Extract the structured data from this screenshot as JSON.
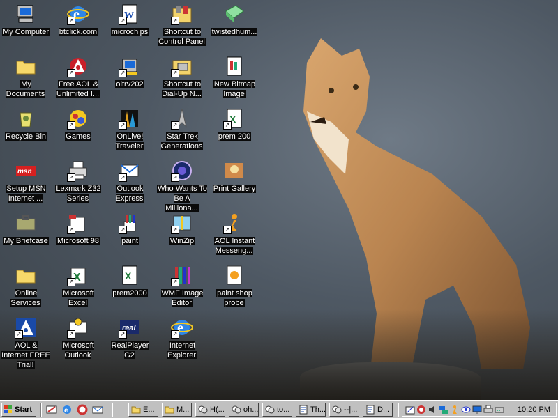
{
  "desktop": {
    "icons": [
      {
        "label": "My Computer",
        "icon": "my-computer-icon",
        "shortcut": false
      },
      {
        "label": "btclick.com",
        "icon": "ie-icon",
        "shortcut": true
      },
      {
        "label": "microchips",
        "icon": "word-doc-icon",
        "shortcut": true
      },
      {
        "label": "Shortcut to Control Panel",
        "icon": "control-panel-icon",
        "shortcut": true
      },
      {
        "label": "twistedhum...",
        "icon": "package-icon",
        "shortcut": false
      },
      {
        "label": "My Documents",
        "icon": "folder-icon",
        "shortcut": false
      },
      {
        "label": "Free AOL & Unlimited I...",
        "icon": "aol-icon",
        "shortcut": true
      },
      {
        "label": "oltrv202",
        "icon": "installer-icon",
        "shortcut": true
      },
      {
        "label": "Shortcut to Dial-Up N...",
        "icon": "dialup-icon",
        "shortcut": true
      },
      {
        "label": "New Bitmap Image",
        "icon": "bitmap-icon",
        "shortcut": false
      },
      {
        "label": "Recycle Bin",
        "icon": "recycle-bin-icon",
        "shortcut": false
      },
      {
        "label": "Games",
        "icon": "games-icon",
        "shortcut": true
      },
      {
        "label": "OnLive! Traveler",
        "icon": "onlive-icon",
        "shortcut": true
      },
      {
        "label": "Star Trek Generations",
        "icon": "star-trek-icon",
        "shortcut": true
      },
      {
        "label": "prem 200",
        "icon": "excel-doc-icon",
        "shortcut": true
      },
      {
        "label": "Setup MSN Internet ...",
        "icon": "msn-icon",
        "shortcut": false
      },
      {
        "label": "Lexmark Z32 Series",
        "icon": "printer-icon",
        "shortcut": true
      },
      {
        "label": "Outlook Express",
        "icon": "outlook-express-icon",
        "shortcut": true
      },
      {
        "label": "Who Wants To Be A Milliona...",
        "icon": "millionaire-icon",
        "shortcut": true
      },
      {
        "label": "Print Gallery",
        "icon": "print-gallery-icon",
        "shortcut": false
      },
      {
        "label": "My Briefcase",
        "icon": "briefcase-icon",
        "shortcut": false
      },
      {
        "label": "Microsoft  98",
        "icon": "ms98-icon",
        "shortcut": true
      },
      {
        "label": "paint",
        "icon": "paint-icon",
        "shortcut": true
      },
      {
        "label": "WinZip",
        "icon": "winzip-icon",
        "shortcut": true
      },
      {
        "label": "AOL Instant Messeng...",
        "icon": "aim-icon",
        "shortcut": true
      },
      {
        "label": "Online Services",
        "icon": "folder-icon",
        "shortcut": false
      },
      {
        "label": "Microsoft Excel",
        "icon": "excel-icon",
        "shortcut": true
      },
      {
        "label": "prem2000",
        "icon": "excel-doc-icon",
        "shortcut": false
      },
      {
        "label": "WMF Image Editor",
        "icon": "wmf-editor-icon",
        "shortcut": true
      },
      {
        "label": "paint shop probe",
        "icon": "paint-shop-icon",
        "shortcut": false
      },
      {
        "label": "AOL & Internet FREE Trial!",
        "icon": "aol-triangle-icon",
        "shortcut": true
      },
      {
        "label": "Microsoft Outlook",
        "icon": "outlook-icon",
        "shortcut": true
      },
      {
        "label": "RealPlayer G2",
        "icon": "realplayer-icon",
        "shortcut": true
      },
      {
        "label": "Internet Explorer",
        "icon": "ie-icon",
        "shortcut": true
      }
    ]
  },
  "taskbar": {
    "start_label": "Start",
    "quick_launch": [
      "show-desktop-icon",
      "ie-icon",
      "lifebuoy-icon",
      "outlook-express-icon"
    ],
    "tasks": [
      {
        "label": "E...",
        "icon": "folder-window-icon"
      },
      {
        "label": "M...",
        "icon": "folder-window-icon"
      },
      {
        "label": "H(...",
        "icon": "chat-icon"
      },
      {
        "label": "oh...",
        "icon": "chat-icon"
      },
      {
        "label": "to...",
        "icon": "chat-icon"
      },
      {
        "label": "Th...",
        "icon": "document-window-icon"
      },
      {
        "label": "--|...",
        "icon": "chat-icon"
      },
      {
        "label": "D...",
        "icon": "document-window-icon"
      }
    ],
    "tray_icons": [
      "task-scheduler-icon",
      "antivirus-icon",
      "volume-icon",
      "network-icon",
      "aim-tray-icon",
      "eye-icon",
      "display-icon",
      "printer-tray-icon",
      "modem-icon"
    ],
    "clock": "10:20 PM"
  }
}
